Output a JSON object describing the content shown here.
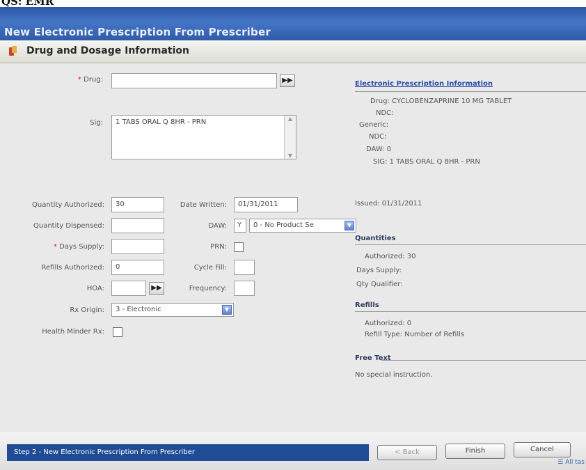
{
  "top_label": "QS: EMR",
  "window_title": "New Electronic Prescription From Prescriber",
  "section_title": "Drug and Dosage Information",
  "form": {
    "drug_label": "Drug:",
    "drug_value": "",
    "sig_label": "Sig:",
    "sig_value": "1 TABS ORAL Q 8HR - PRN",
    "qty_auth_label": "Quantity Authorized:",
    "qty_auth_value": "30",
    "qty_disp_label": "Quantity Dispensed:",
    "qty_disp_value": "",
    "days_supply_label": "Days Supply:",
    "days_supply_value": "",
    "refills_label": "Refills Authorized:",
    "refills_value": "0",
    "hoa_label": "HOA:",
    "hoa_value": "",
    "rx_origin_label": "Rx Origin:",
    "rx_origin_value": "3 - Electronic",
    "health_minder_label": "Health Minder Rx:",
    "date_written_label": "Date Written:",
    "date_written_value": "01/31/2011",
    "daw_label": "DAW:",
    "daw_code": "Y",
    "daw_select": "0 - No Product Se",
    "prn_label": "PRN:",
    "cycle_fill_label": "Cycle Fill:",
    "frequency_label": "Frequency:"
  },
  "info": {
    "header": "Electronic Prescription Information",
    "drug_label": "Drug:",
    "drug_value": "CYCLOBENZAPRINE 10 MG TABLET",
    "ndc_label": "NDC:",
    "generic_label": "Generic:",
    "generic_ndc_label": "NDC:",
    "daw_label": "DAW:",
    "daw_value": "0",
    "sig_label": "SIG:",
    "sig_value": "1 TABS ORAL Q 8HR - PRN",
    "issued_label": "Issued:",
    "issued_value": "01/31/2011",
    "quantities_header": "Quantities",
    "authorized_label": "Authorized:",
    "authorized_value": "30",
    "days_supply_label": "Days Supply:",
    "qty_qualifier_label": "Qty Qualifier:",
    "refills_header": "Refills",
    "refills_authorized_label": "Authorized:",
    "refills_authorized_value": "0",
    "refill_type_label": "Refill Type:",
    "refill_type_value": "Number of Refills",
    "free_text_header": "Free Text",
    "free_text_value": "No special instruction."
  },
  "footer": {
    "step": "Step 2 - New Electronic Prescription From Prescriber",
    "back": "< Back",
    "finish": "Finish",
    "cancel": "Cancel",
    "all_tasks": "All tas"
  }
}
